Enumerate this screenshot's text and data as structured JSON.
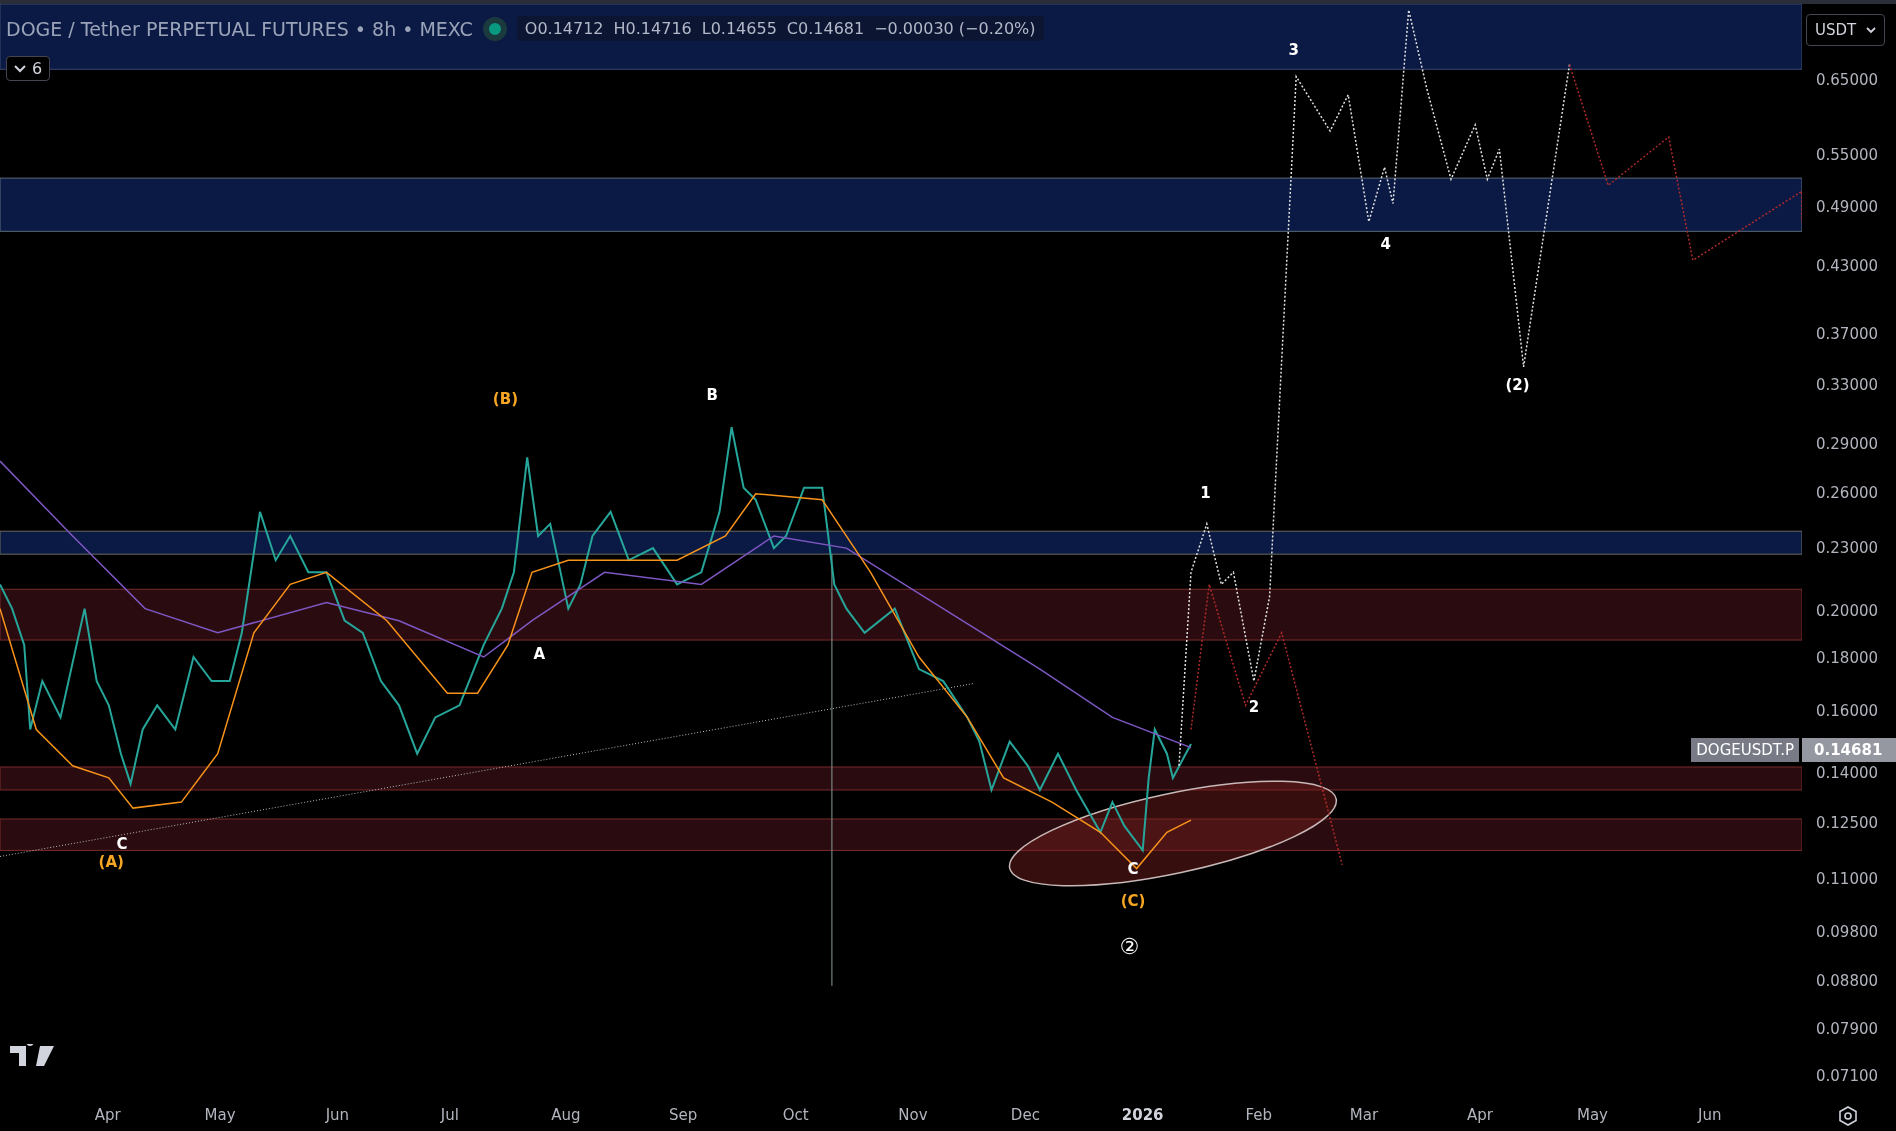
{
  "legend": {
    "title": "DOGE / Tether PERPETUAL FUTURES • 8h • MEXC",
    "market_open": true,
    "ohlc": [
      "O0.14712",
      "H0.14716",
      "L0.14655",
      "C0.14681"
    ],
    "change": "−0.00030 (−0.20%)"
  },
  "indicators_toggle": {
    "count": "6",
    "expanded": false
  },
  "currency": {
    "label": "USDT"
  },
  "wave_labels": [
    {
      "text": "(B)",
      "color": "#f5a623"
    },
    {
      "text": "B",
      "color": "#ffffff"
    },
    {
      "text": "A",
      "color": "#ffffff"
    },
    {
      "text": "C",
      "color": "#ffffff"
    },
    {
      "text": "(A)",
      "color": "#f5a623"
    },
    {
      "text": "C",
      "color": "#ffffff"
    },
    {
      "text": "(C)",
      "color": "#f5a623"
    },
    {
      "text": "②",
      "color": "#ffffff"
    },
    {
      "text": "1",
      "color": "#ffffff"
    },
    {
      "text": "2",
      "color": "#ffffff"
    },
    {
      "text": "3",
      "color": "#ffffff"
    },
    {
      "text": "4",
      "color": "#ffffff"
    },
    {
      "text": "(2)",
      "color": "#ffffff"
    }
  ],
  "price_axis": {
    "labels": [
      "0.65000",
      "0.55000",
      "0.49000",
      "0.43000",
      "0.37000",
      "0.33000",
      "0.29000",
      "0.26000",
      "0.23000",
      "0.20000",
      "0.18000",
      "0.16000",
      "0.14000",
      "0.12500",
      "0.11000",
      "0.09800",
      "0.08800",
      "0.07900",
      "0.07100"
    ]
  },
  "last_price": {
    "symbol": "DOGEUSDT.P",
    "price": "0.14681"
  },
  "time_axis": {
    "labels": [
      {
        "text": "Apr",
        "kind": "month"
      },
      {
        "text": "May",
        "kind": "month"
      },
      {
        "text": "Jun",
        "kind": "month"
      },
      {
        "text": "Jul",
        "kind": "month"
      },
      {
        "text": "Aug",
        "kind": "month"
      },
      {
        "text": "Sep",
        "kind": "month"
      },
      {
        "text": "Oct",
        "kind": "month"
      },
      {
        "text": "Nov",
        "kind": "month"
      },
      {
        "text": "Dec",
        "kind": "month"
      },
      {
        "text": "2026",
        "kind": "year"
      },
      {
        "text": "Feb",
        "kind": "month"
      },
      {
        "text": "Mar",
        "kind": "month"
      },
      {
        "text": "Apr",
        "kind": "month"
      },
      {
        "text": "May",
        "kind": "month"
      },
      {
        "text": "Jun",
        "kind": "month"
      }
    ]
  }
}
